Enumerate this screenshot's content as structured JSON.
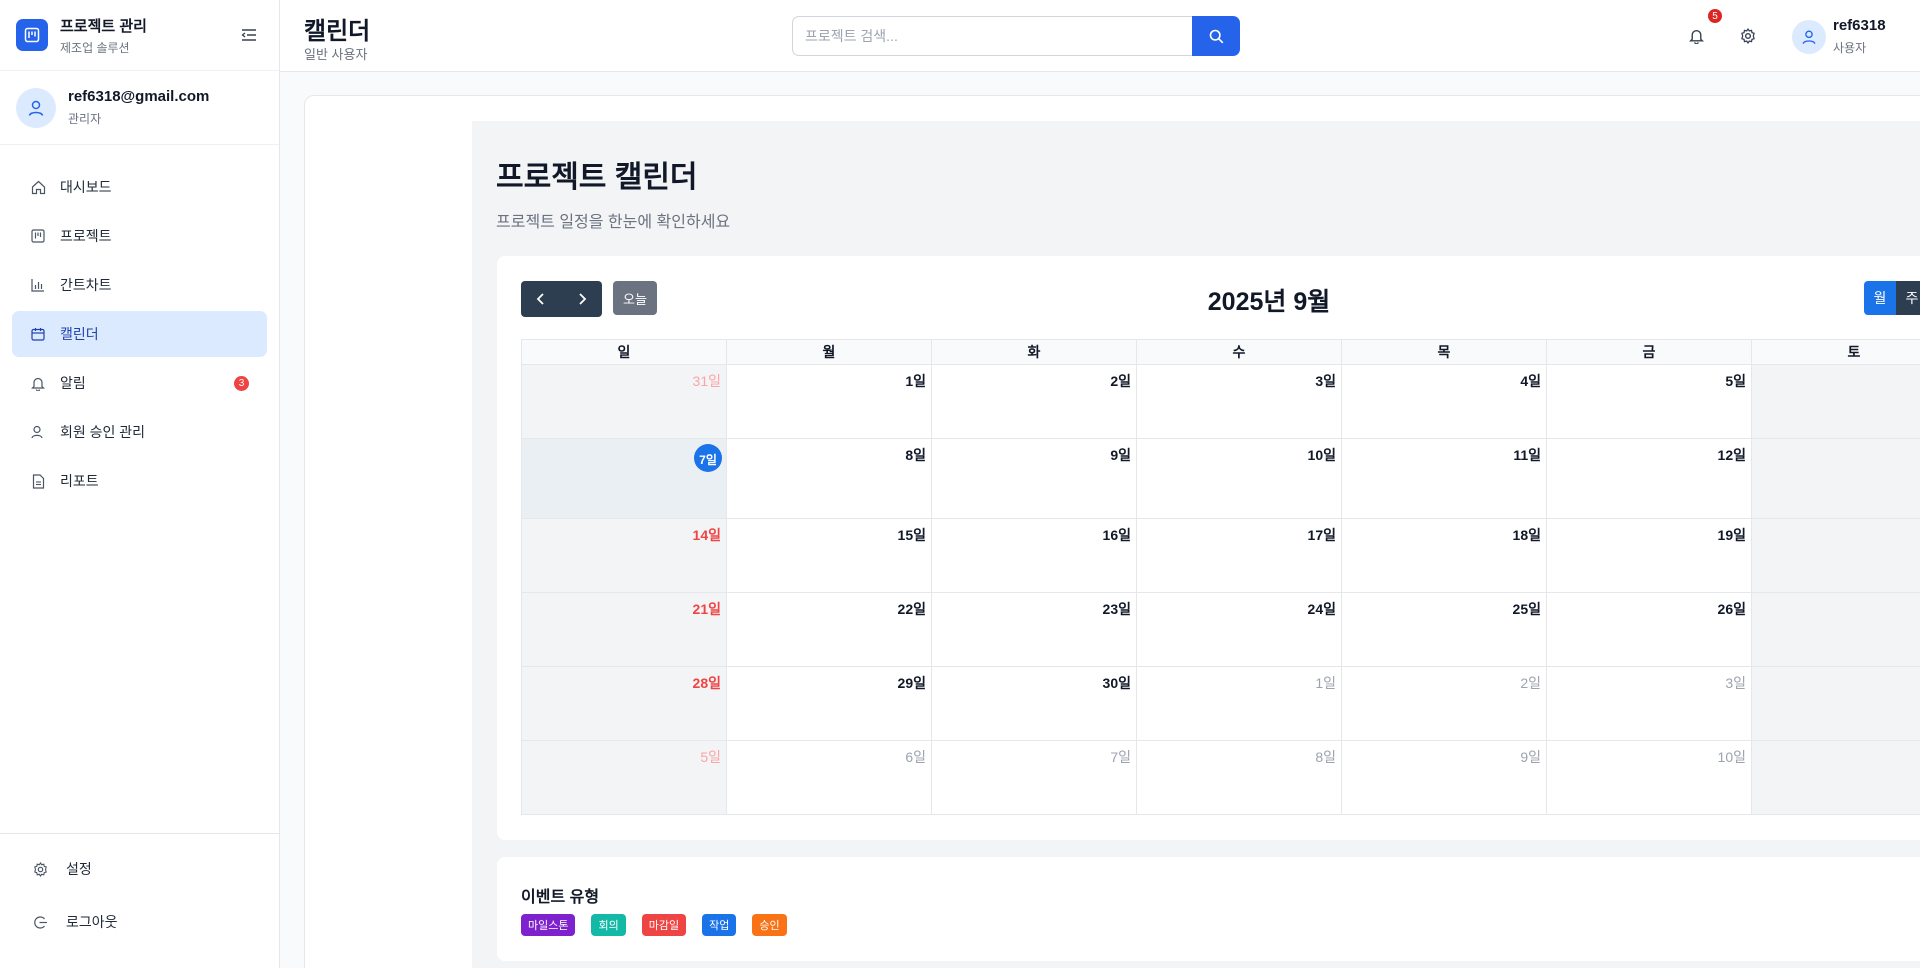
{
  "sidebar": {
    "brand_title": "프로젝트 관리",
    "brand_sub": "제조업 솔루션",
    "profile_email": "ref6318@gmail.com",
    "profile_role": "관리자",
    "items": [
      {
        "label": "대시보드",
        "icon": "home-icon"
      },
      {
        "label": "프로젝트",
        "icon": "kanban-icon"
      },
      {
        "label": "간트차트",
        "icon": "bar-chart-icon"
      },
      {
        "label": "캘린더",
        "icon": "calendar-icon",
        "active": true
      },
      {
        "label": "알림",
        "icon": "bell-icon",
        "badge": "3"
      },
      {
        "label": "회원 승인 관리",
        "icon": "user-check-icon"
      },
      {
        "label": "리포트",
        "icon": "file-icon"
      }
    ],
    "bottom": [
      {
        "label": "설정",
        "icon": "gear-icon"
      },
      {
        "label": "로그아웃",
        "icon": "logout-icon"
      }
    ]
  },
  "header": {
    "title": "캘린더",
    "subtitle": "일반 사용자",
    "search_placeholder": "프로젝트 검색...",
    "notification_count": "5",
    "user_name": "ref6318",
    "user_role": "사용자"
  },
  "page": {
    "title": "프로젝트 캘린더",
    "subtitle": "프로젝트 일정을 한눈에 확인하세요"
  },
  "calendar": {
    "month_label": "2025년 9월",
    "today_label": "오늘",
    "view_month": "월",
    "view_week": "주",
    "weekdays": [
      "일",
      "월",
      "화",
      "수",
      "목",
      "금",
      "토"
    ],
    "today_cell": "7일",
    "weeks": [
      [
        "31일",
        "1일",
        "2일",
        "3일",
        "4일",
        "5일",
        ""
      ],
      [
        "",
        "8일",
        "9일",
        "10일",
        "11일",
        "12일",
        ""
      ],
      [
        "14일",
        "15일",
        "16일",
        "17일",
        "18일",
        "19일",
        ""
      ],
      [
        "21일",
        "22일",
        "23일",
        "24일",
        "25일",
        "26일",
        ""
      ],
      [
        "28일",
        "29일",
        "30일",
        "1일",
        "2일",
        "3일",
        ""
      ],
      [
        "5일",
        "6일",
        "7일",
        "8일",
        "9일",
        "10일",
        ""
      ]
    ]
  },
  "legend": {
    "title": "이벤트 유형",
    "tags": [
      {
        "label": "마일스톤",
        "color": "#7e22ce"
      },
      {
        "label": "회의",
        "color": "#14b8a6"
      },
      {
        "label": "마감일",
        "color": "#ef4444"
      },
      {
        "label": "작업",
        "color": "#1a73e8"
      },
      {
        "label": "승인",
        "color": "#f97316"
      }
    ]
  },
  "colors": {
    "accent": "#2563eb",
    "active_bg": "#dbeafe",
    "danger": "#ef4444"
  }
}
